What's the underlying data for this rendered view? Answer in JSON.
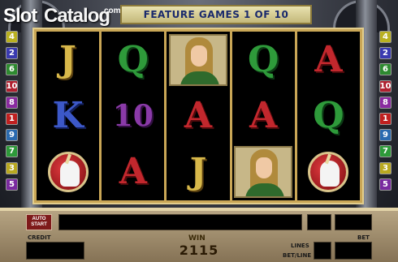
{
  "header": {
    "logo_slot": "Slot",
    "logo_catalog": "Catalog",
    "logo_com": "com",
    "feature_banner": "FEATURE GAMES 1 OF 10"
  },
  "line_buttons": {
    "left": [
      {
        "label": "4",
        "color": "#b9b020"
      },
      {
        "label": "2",
        "color": "#3a3ab0"
      },
      {
        "label": "6",
        "color": "#2e8a30"
      },
      {
        "label": "10",
        "color": "#b02030"
      },
      {
        "label": "8",
        "color": "#8a2aa0"
      },
      {
        "label": "1",
        "color": "#c02020"
      },
      {
        "label": "9",
        "color": "#2a6ab0"
      },
      {
        "label": "7",
        "color": "#2e9a3a"
      },
      {
        "label": "3",
        "color": "#b9a820"
      },
      {
        "label": "5",
        "color": "#7a2aa0"
      }
    ],
    "right": [
      {
        "label": "4",
        "color": "#b9b020"
      },
      {
        "label": "2",
        "color": "#3a3ab0"
      },
      {
        "label": "6",
        "color": "#2e8a30"
      },
      {
        "label": "10",
        "color": "#b02030"
      },
      {
        "label": "8",
        "color": "#8a2aa0"
      },
      {
        "label": "1",
        "color": "#c02020"
      },
      {
        "label": "9",
        "color": "#2a6ab0"
      },
      {
        "label": "7",
        "color": "#2e9a3a"
      },
      {
        "label": "3",
        "color": "#b9a820"
      },
      {
        "label": "5",
        "color": "#7a2aa0"
      }
    ]
  },
  "reels": [
    [
      "J",
      "K",
      "unicorn"
    ],
    [
      "Q",
      "10",
      "A"
    ],
    [
      "maiden",
      "A",
      "J"
    ],
    [
      "Q",
      "A",
      "maiden"
    ],
    [
      "A",
      "Q",
      "unicorn"
    ]
  ],
  "panel": {
    "autostart_label": "AUTO START",
    "credit_label": "CREDIT",
    "win_label": "WIN",
    "win_value": "2115",
    "lines_label": "LINES",
    "bet_line_label": "BET/LINE",
    "bet_label": "BET"
  }
}
